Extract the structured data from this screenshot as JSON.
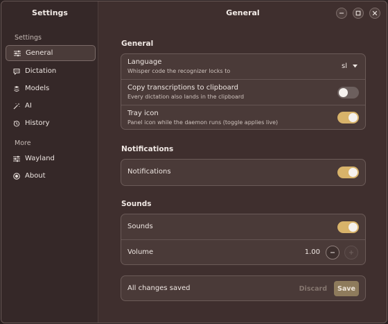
{
  "sidebar": {
    "title": "Settings",
    "sections": [
      {
        "label": "Settings",
        "items": [
          {
            "label": "General",
            "icon": "sliders-icon",
            "active": true
          },
          {
            "label": "Dictation",
            "icon": "speech-bubble-icon"
          },
          {
            "label": "Models",
            "icon": "layers-icon"
          },
          {
            "label": "AI",
            "icon": "magic-wand-icon"
          },
          {
            "label": "History",
            "icon": "history-clock-icon"
          }
        ]
      },
      {
        "label": "More",
        "items": [
          {
            "label": "Wayland",
            "icon": "sliders-icon"
          },
          {
            "label": "About",
            "icon": "info-circle-icon"
          }
        ]
      }
    ]
  },
  "header": {
    "title": "General"
  },
  "general": {
    "title": "General",
    "language": {
      "label": "Language",
      "subtitle": "Whisper code the recognizer locks to",
      "value": "sl"
    },
    "copy": {
      "label": "Copy transcriptions to clipboard",
      "subtitle": "Every dictation also lands in the clipboard",
      "enabled": false
    },
    "tray": {
      "label": "Tray icon",
      "subtitle": "Panel icon while the daemon runs (toggle applies live)",
      "enabled": true
    }
  },
  "notifications": {
    "title": "Notifications",
    "toggle": {
      "label": "Notifications",
      "enabled": true
    }
  },
  "sounds": {
    "title": "Sounds",
    "toggle": {
      "label": "Sounds",
      "enabled": true
    },
    "volume": {
      "label": "Volume",
      "value": "1.00"
    }
  },
  "footer": {
    "status": "All changes saved",
    "discard_label": "Discard",
    "save_label": "Save"
  },
  "colors": {
    "accent": "#d8b36a",
    "background": "#3f2f2e",
    "sidebar": "#352828",
    "card": "#4a3a38"
  }
}
